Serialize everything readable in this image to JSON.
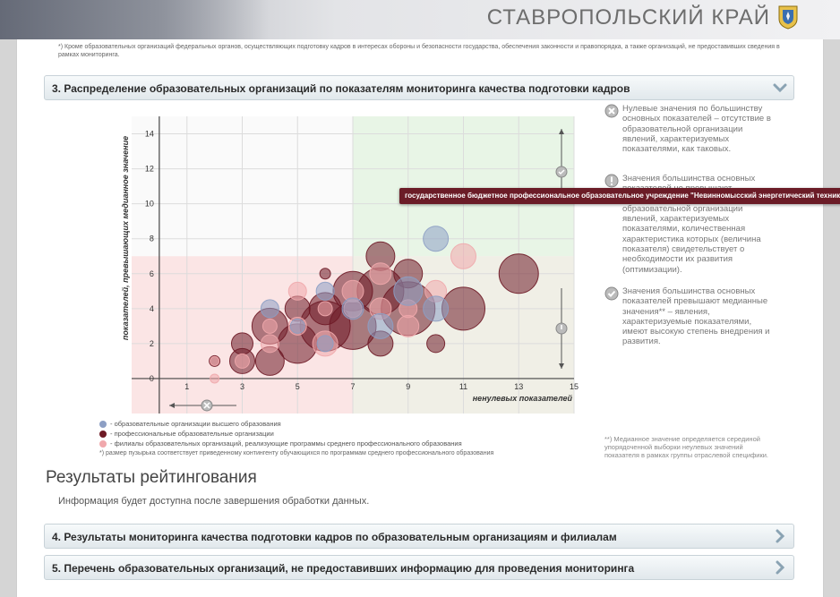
{
  "header": {
    "region": "СТАВРОПОЛЬСКИЙ КРАЙ"
  },
  "footnote_top": "*) Кроме образовательных организаций федеральных органов, осуществляющих подготовку кадров в интересах обороны и безопасности государства, обеспечения законности и правопорядка, а также организаций, не предоставивших сведения в рамках мониторинга.",
  "sections": {
    "s3": "3. Распределение образовательных организаций по показателям мониторинга качества подготовки кадров",
    "s4": "4. Результаты мониторинга качества подготовки кадров по образовательным организациям и филиалам",
    "s5": "5. Перечень образовательных организаций, не предоставивших информацию для проведения мониторинга"
  },
  "side_notes": {
    "zero": "Нулевые значения по большинству основных показателей – отсутствие в образовательной организации явлений, характеризуемых показателями, как таковых.",
    "below": "Значения большинства основных показателей не превышают медианного значения** – наличие в образовательной организации явлений, характеризуемых показателями, количественная характеристика которых (величина показателя) свидетельствует о необходимости их развития (оптимизации).",
    "above": "Значения большинства основных показателей превышают медианные значения** – явления, характеризуемые показателями, имеют высокую степень внедрения и развития.",
    "median_note": "**) Медианное значение определяется серединой упорядоченной выборки неулевых значений показателя в рамках группы отраслевой специфики."
  },
  "tooltip": "государственное бюджетное профессиональное образовательное учреждение \"Невинномысский энергетический техникум\"",
  "legend": {
    "higher": "- образовательные организации высшего образования",
    "prof": "- профессиональные образовательные организации",
    "branch": "- филиалы образовательных организаций, реализующие программы среднего профессионального образования",
    "size_note": "*) размер пузырька соответствует приведенному контингенту обучающихся по программам среднего профессионального образования"
  },
  "results": {
    "title": "Результаты рейтингования",
    "text": "Информация будет доступна после завершения обработки данных."
  },
  "colors": {
    "higher": "#8d9fc4",
    "prof": "#6e1a26",
    "branch": "#f0a8ac"
  },
  "chart_data": {
    "type": "scatter",
    "xlabel": "ненулевых показателей",
    "ylabel": "показателей, превышающих медианное значение",
    "xlim": [
      -1,
      15
    ],
    "ylim": [
      -2,
      15
    ],
    "xticks": [
      1,
      3,
      5,
      7,
      9,
      11,
      13,
      15
    ],
    "yticks": [
      0,
      2,
      4,
      6,
      8,
      10,
      12,
      14
    ],
    "median_x": 7,
    "median_y": 7,
    "series": [
      {
        "key": "higher",
        "points": [
          [
            10,
            8,
            14
          ],
          [
            9,
            5,
            16
          ],
          [
            8,
            3,
            14
          ],
          [
            5,
            3,
            8
          ],
          [
            6,
            2,
            9
          ],
          [
            4,
            4,
            10
          ],
          [
            7,
            4,
            12
          ],
          [
            10,
            4,
            14
          ],
          [
            6,
            5,
            10
          ]
        ]
      },
      {
        "key": "prof",
        "points": [
          [
            13,
            6,
            22
          ],
          [
            8,
            7,
            16
          ],
          [
            9,
            4,
            30
          ],
          [
            7,
            5,
            22
          ],
          [
            6,
            3,
            28
          ],
          [
            5,
            2,
            22
          ],
          [
            4,
            1,
            16
          ],
          [
            3,
            1,
            14
          ],
          [
            2,
            1,
            6
          ],
          [
            6,
            6,
            6
          ],
          [
            8,
            2,
            14
          ],
          [
            10,
            2,
            10
          ],
          [
            11,
            4,
            24
          ],
          [
            7,
            3,
            26
          ],
          [
            8,
            5,
            26
          ],
          [
            5,
            4,
            14
          ],
          [
            9,
            6,
            16
          ],
          [
            6,
            4,
            18
          ],
          [
            4,
            3,
            20
          ],
          [
            3,
            2,
            12
          ]
        ]
      },
      {
        "key": "branch",
        "points": [
          [
            11,
            7,
            14
          ],
          [
            10,
            5,
            12
          ],
          [
            8,
            4,
            12
          ],
          [
            8,
            6,
            12
          ],
          [
            7,
            4,
            10
          ],
          [
            6,
            2,
            14
          ],
          [
            5,
            3,
            10
          ],
          [
            4,
            2,
            10
          ],
          [
            3,
            1,
            8
          ],
          [
            2,
            0,
            5
          ],
          [
            2,
            1,
            5
          ],
          [
            9,
            3,
            12
          ],
          [
            5,
            5,
            10
          ],
          [
            6,
            4,
            8
          ],
          [
            7,
            5,
            12
          ],
          [
            4,
            3,
            8
          ],
          [
            9,
            4,
            10
          ]
        ]
      }
    ]
  }
}
